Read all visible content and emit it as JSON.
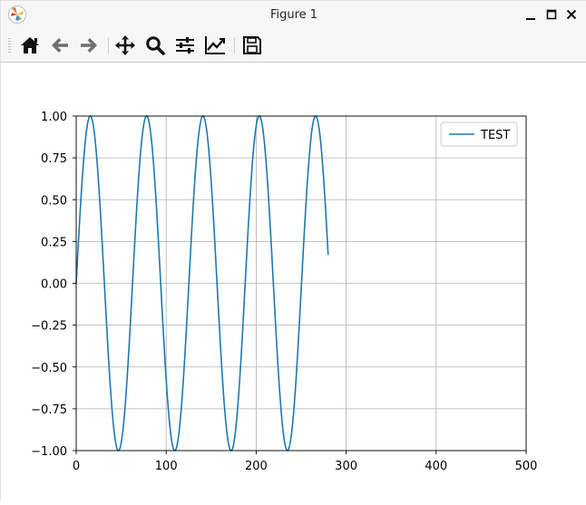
{
  "window": {
    "title": "Figure 1"
  },
  "toolbar": {
    "buttons": [
      {
        "name": "home",
        "icon": "home-icon"
      },
      {
        "name": "back",
        "icon": "arrow-left-icon"
      },
      {
        "name": "forward",
        "icon": "arrow-right-icon"
      },
      {
        "name": "pan",
        "icon": "move-icon"
      },
      {
        "name": "zoom",
        "icon": "zoom-icon"
      },
      {
        "name": "subplots",
        "icon": "sliders-icon"
      },
      {
        "name": "customize",
        "icon": "line-chart-icon"
      },
      {
        "name": "save",
        "icon": "save-icon"
      }
    ]
  },
  "chart_data": {
    "type": "line",
    "xlim": [
      0,
      500
    ],
    "ylim": [
      -1.0,
      1.0
    ],
    "xticks": [
      0,
      100,
      200,
      300,
      400,
      500
    ],
    "yticks": [
      -1.0,
      -0.75,
      -0.5,
      -0.25,
      0.0,
      0.25,
      0.5,
      0.75,
      1.0
    ],
    "xtick_labels": [
      "0",
      "100",
      "200",
      "300",
      "400",
      "500"
    ],
    "ytick_labels": [
      "−1.00",
      "−0.75",
      "−0.50",
      "−0.25",
      "0.00",
      "0.25",
      "0.50",
      "0.75",
      "1.00"
    ],
    "grid": true,
    "legend": {
      "position": "upper right",
      "entries": [
        "TEST"
      ]
    },
    "series": [
      {
        "name": "TEST",
        "color": "#1f77b4",
        "function": "sin",
        "x_start": 0,
        "x_end": 280,
        "period": 62.6,
        "y_end": 0.18
      }
    ]
  }
}
